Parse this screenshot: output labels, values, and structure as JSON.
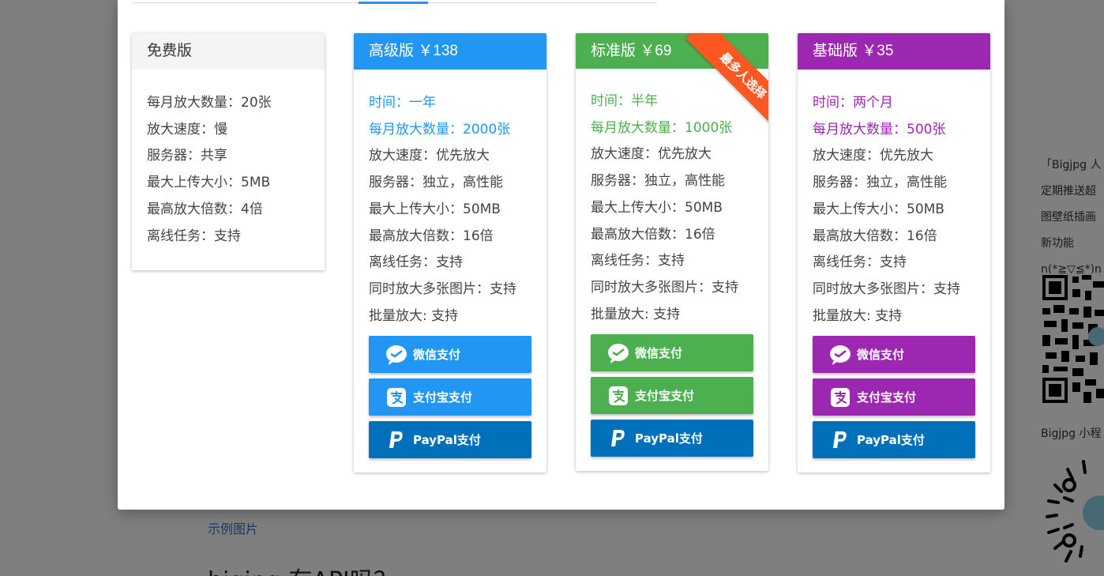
{
  "background": {
    "example_link": "示例图片",
    "heading": "bigjpg 有API吗？",
    "side_lines": [
      "「Bigjpg 人",
      "定期推送超",
      "图壁纸插画",
      "新功能",
      "n(*≧▽≦*)n"
    ],
    "mini_program": "Bigjpg 小程"
  },
  "plans": {
    "free": {
      "title": "免费版",
      "features": [
        "每月放大数量：20张",
        "放大速度：慢",
        "服务器：共享",
        "最大上传大小：5MB",
        "最高放大倍数：4倍",
        "离线任务：支持"
      ]
    },
    "advanced": {
      "title": "高级版 ￥138",
      "highlights": [
        "时间：一年",
        "每月放大数量：2000张"
      ],
      "features": [
        "放大速度：优先放大",
        "服务器：独立，高性能",
        "最大上传大小：50MB",
        "最高放大倍数：16倍",
        "离线任务：支持",
        "同时放大多张图片：支持",
        "批量放大: 支持"
      ]
    },
    "standard": {
      "title": "标准版 ￥69",
      "ribbon": "最多人选择",
      "highlights": [
        "时间：半年",
        "每月放大数量：1000张"
      ],
      "features": [
        "放大速度：优先放大",
        "服务器：独立，高性能",
        "最大上传大小：50MB",
        "最高放大倍数：16倍",
        "离线任务：支持",
        "同时放大多张图片：支持",
        "批量放大: 支持"
      ]
    },
    "basic": {
      "title": "基础版 ￥35",
      "highlights": [
        "时间：两个月",
        "每月放大数量：500张"
      ],
      "features": [
        "放大速度：优先放大",
        "服务器：独立，高性能",
        "最大上传大小：50MB",
        "最高放大倍数：16倍",
        "离线任务：支持",
        "同时放大多张图片：支持",
        "批量放大: 支持"
      ]
    }
  },
  "buttons": {
    "wechat": "微信支付",
    "alipay": "支付宝支付",
    "paypal": "PayPal支付"
  },
  "colors": {
    "advanced": "#2196f3",
    "standard": "#4caf50",
    "basic": "#9c27b0",
    "paypal": "#0070ba",
    "ribbon": "#ff5722"
  }
}
